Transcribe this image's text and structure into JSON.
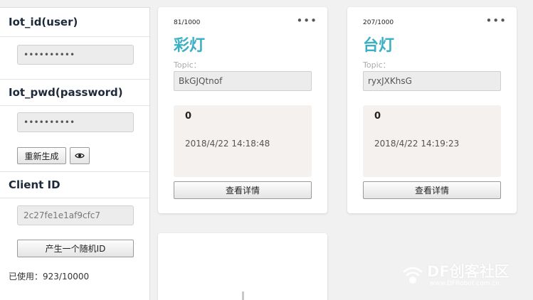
{
  "sidebar": {
    "iot_id_label": "Iot_id(user)",
    "iot_id_value": "••••••••••",
    "iot_pwd_label": "Iot_pwd(password)",
    "iot_pwd_value": "••••••••••",
    "regenerate_label": "重新生成",
    "eye_icon": "eye-icon",
    "client_id_label": "Client ID",
    "client_id_value": "2c27fe1e1af9cfc7",
    "random_id_label": "产生一个随机ID",
    "usage_text": "已使用：923/10000"
  },
  "cards": [
    {
      "count": "81/1000",
      "menu_icon": "more-icon",
      "title": "彩灯",
      "topic_label": "Topic：",
      "topic_value": "BkGJQtnof",
      "value": "0",
      "timestamp": "2018/4/22 14:18:48",
      "detail_label": "查看详情"
    },
    {
      "count": "207/1000",
      "menu_icon": "more-icon",
      "title": "台灯",
      "topic_label": "Topic：",
      "topic_value": "ryxJXKhsG",
      "value": "0",
      "timestamp": "2018/4/22 14:19:23",
      "detail_label": "查看详情"
    }
  ],
  "watermark": {
    "brand": "DF创客社区",
    "url": "www.DFRobot.com.cn"
  },
  "colors": {
    "accent": "#3bb0c4",
    "background": "#f1f1f1",
    "value_box": "#f4f1ee"
  }
}
